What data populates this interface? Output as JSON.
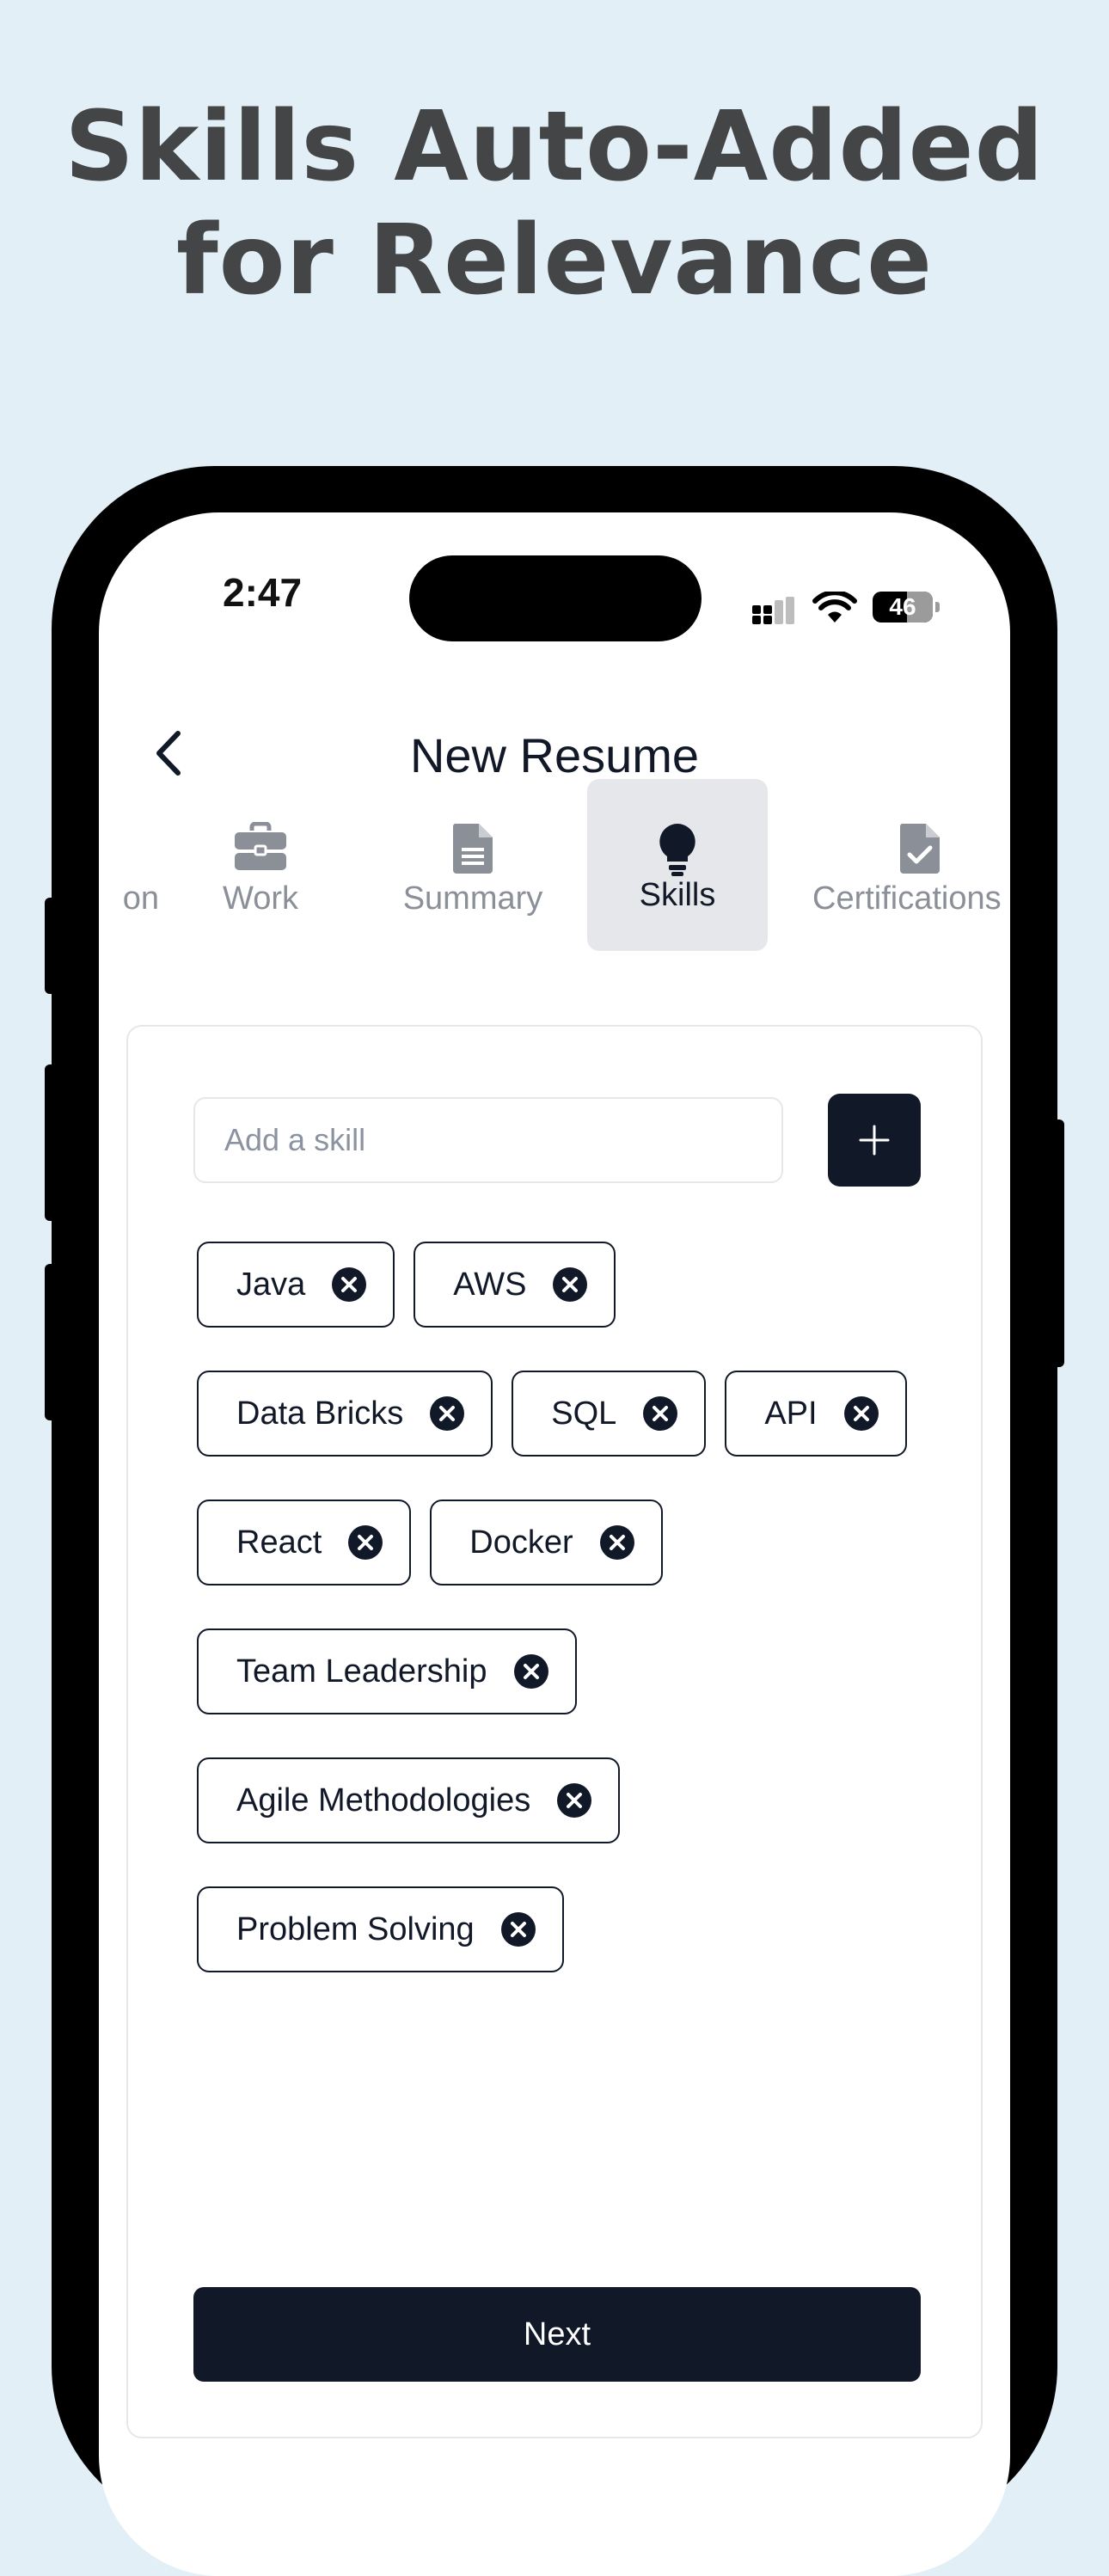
{
  "headline": {
    "line1": "Skills Auto-Added",
    "line2": "for Relevance"
  },
  "status_bar": {
    "time": "2:47",
    "battery": "46"
  },
  "nav": {
    "title": "New Resume"
  },
  "tabs": [
    {
      "label": "on",
      "icon": "partial-tab"
    },
    {
      "label": "Work",
      "icon": "briefcase-icon"
    },
    {
      "label": "Summary",
      "icon": "document-icon"
    },
    {
      "label": "Skills",
      "icon": "lightbulb-icon",
      "active": true
    },
    {
      "label": "Certifications",
      "icon": "certificate-icon"
    }
  ],
  "skills_input": {
    "placeholder": "Add a skill",
    "value": ""
  },
  "skills": {
    "row1": [
      "Java",
      "AWS"
    ],
    "row2": [
      "Data Bricks",
      "SQL",
      "API"
    ],
    "row3": [
      "React",
      "Docker"
    ],
    "row4": [
      "Team Leadership"
    ],
    "row5": [
      "Agile Methodologies"
    ],
    "row6": [
      "Problem Solving"
    ]
  },
  "actions": {
    "next": "Next"
  },
  "colors": {
    "background": "#e3eff6",
    "primary": "#111827",
    "muted": "#8a8f98"
  }
}
